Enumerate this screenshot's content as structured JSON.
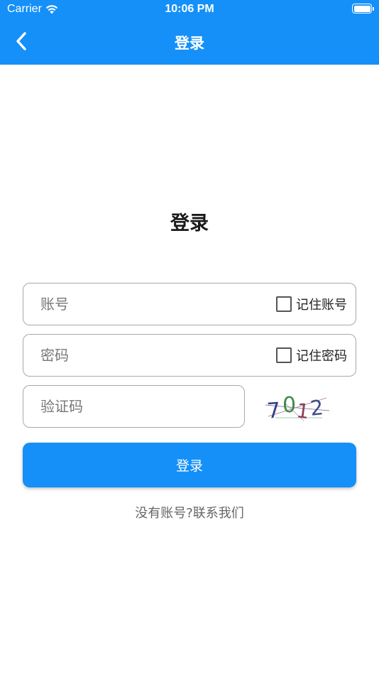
{
  "status_bar": {
    "carrier": "Carrier",
    "time": "10:06 PM",
    "wifi_icon": "wifi-icon",
    "battery_icon": "battery-icon"
  },
  "nav": {
    "back_icon": "chevron-left-icon",
    "title": "登录"
  },
  "form": {
    "heading": "登录",
    "account": {
      "placeholder": "账号",
      "value": "",
      "remember_label": "记住账号",
      "remember_checked": false
    },
    "password": {
      "placeholder": "密码",
      "value": "",
      "remember_label": "记住密码",
      "remember_checked": false
    },
    "captcha": {
      "placeholder": "验证码",
      "value": "",
      "code": [
        "7",
        "0",
        "1",
        "2"
      ]
    },
    "submit_label": "登录",
    "contact_link": "没有账号?联系我们"
  },
  "colors": {
    "primary": "#1490f8",
    "border": "#a8a8a8",
    "muted_text": "#666666"
  }
}
